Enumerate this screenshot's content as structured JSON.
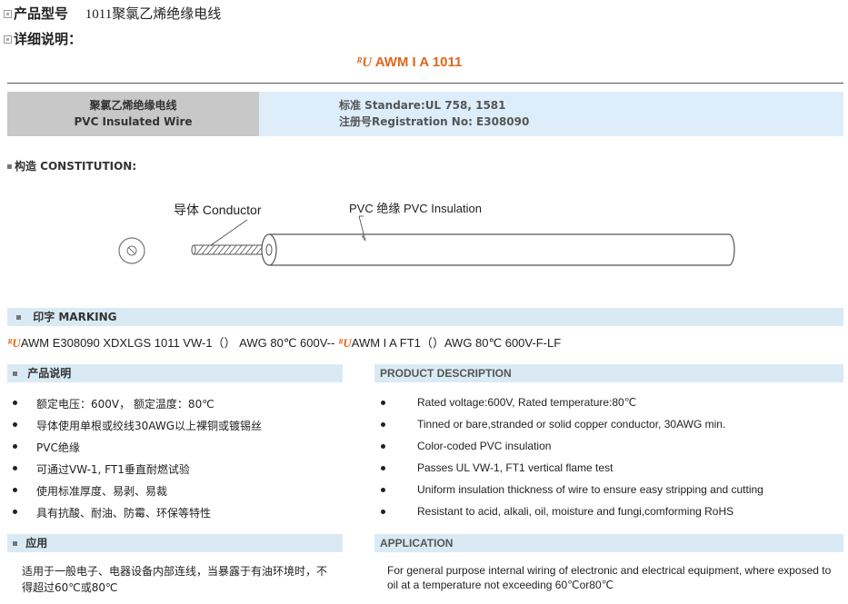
{
  "header": {
    "model_label": "产品型号",
    "model_value": "1011聚氯乙烯绝缘电线",
    "detail_label": "详细说明："
  },
  "logo": {
    "ul_mark": "ᴿU",
    "awm_text": "AWM I A 1011"
  },
  "spec_box": {
    "name_cn": "聚氯乙烯绝缘电线",
    "name_en": "PVC Insulated Wire",
    "standard": "标准   Standare:UL 758, 1581",
    "registration": "注册号Registration No: E308090"
  },
  "construction": {
    "heading": "构造  CONSTITUTION:",
    "conductor_label": "导体 Conductor",
    "insulation_label": "PVC 绝缘 PVC Insulation"
  },
  "marking": {
    "heading": "印字 MARKING",
    "text1": "AWM E308090 XDXLGS 1011 VW-1（）  AWG 80℃ 600V--",
    "text2": "AWM I A FT1（）AWG 80℃ 600V-F-LF"
  },
  "product_description": {
    "heading_cn": "产品说明",
    "heading_en": "PRODUCT DESCRIPTION",
    "items_cn": [
      "额定电压：600V，  额定温度：80℃",
      "导体使用单根或绞线30AWG以上裸铜或镀锡丝",
      " PVC绝缘",
      "可通过VW-1, FT1垂直耐燃试验",
      "使用标准厚度、易剥、易裁",
      "具有抗酸、耐油、防霉、环保等特性"
    ],
    "items_en": [
      "Rated voltage:600V, Rated temperature:80℃",
      "Tinned or bare,stranded or solid  copper conductor, 30AWG  min.",
      "Color-coded PVC insulation",
      "Passes UL VW-1, FT1 vertical flame test",
      "Uniform insulation thickness of wire to ensure easy stripping and cutting",
      "Resistant to acid, alkali, oil, moisture and fungi,comforming RoHS"
    ]
  },
  "application": {
    "heading_cn": "应用",
    "heading_en": "APPLICATION",
    "text_cn": "适用于一般电子、电器设备内部连线，当暴露于有油环境时，不得超过60℃或80℃",
    "text_en": "For general purpose internal wiring of electronic and electrical equipment, where exposed to oil at a temperature not exceeding 60℃or80℃"
  }
}
